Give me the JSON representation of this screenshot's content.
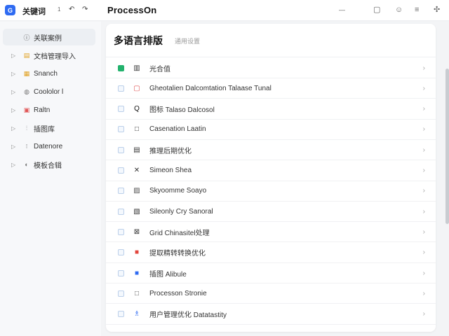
{
  "topbar": {
    "app_name": "关键词",
    "counter": "1",
    "undo_glyph": "↶",
    "redo_glyph": "↷",
    "brand": "ProcessOn"
  },
  "sidebar": {
    "items": [
      {
        "label": "关联案例",
        "icon": "info-circle-icon",
        "glyph": "ⓘ",
        "active": true
      },
      {
        "label": "文档管理导入",
        "icon": "folder-icon",
        "glyph": "▤",
        "active": false
      },
      {
        "label": "Snanch",
        "icon": "orange-box-icon",
        "glyph": "▦",
        "active": false
      },
      {
        "label": "Coololor l",
        "icon": "shield-icon",
        "glyph": "◍",
        "active": false
      },
      {
        "label": "Raltn",
        "icon": "red-file-icon",
        "glyph": "▣",
        "active": false
      },
      {
        "label": "插图库",
        "icon": "tree-icon",
        "glyph": "⫶",
        "active": false
      },
      {
        "label": "Datenore",
        "icon": "dots-icon",
        "glyph": "⁝",
        "active": false
      },
      {
        "label": "模板合辑",
        "icon": "leaf-icon",
        "glyph": "◐",
        "active": false
      }
    ]
  },
  "panel": {
    "title": "多语言排版",
    "subtitle": "通用设置"
  },
  "rows": [
    {
      "label": "光合值",
      "icon": "grid-icon",
      "glyph": "▥",
      "checked": true,
      "color": "#333333"
    },
    {
      "label": "Gheotalien Dalcomtation Talaase Tunal",
      "icon": "lock-icon",
      "glyph": "▢",
      "checked": false,
      "color": "#e05555"
    },
    {
      "label": "图标 Talaso Dalcosol",
      "icon": "q-icon",
      "glyph": "Q",
      "checked": false,
      "color": "#111111"
    },
    {
      "label": "Casenation Laatin",
      "icon": "square-icon",
      "glyph": "□",
      "checked": false,
      "color": "#333333"
    },
    {
      "label": "推理后期优化",
      "icon": "doc-icon",
      "glyph": "▤",
      "checked": false,
      "color": "#333333"
    },
    {
      "label": "Simeon Shea",
      "icon": "crossed-icon",
      "glyph": "✕",
      "checked": false,
      "color": "#333333"
    },
    {
      "label": "Skyoomme Soayo",
      "icon": "image-icon",
      "glyph": "▨",
      "checked": false,
      "color": "#555555"
    },
    {
      "label": "Sileonly Cry Sanoral",
      "icon": "copy-icon",
      "glyph": "▧",
      "checked": false,
      "color": "#333333"
    },
    {
      "label": "Grid Chinasitel处理",
      "icon": "x-grid-icon",
      "glyph": "⊠",
      "checked": false,
      "color": "#333333"
    },
    {
      "label": "提取精转转换优化",
      "icon": "red-square-icon",
      "glyph": "■",
      "checked": false,
      "color": "#e2453c"
    },
    {
      "label": "插图 Alibule",
      "icon": "blue-square-icon",
      "glyph": "■",
      "checked": false,
      "color": "#2f6bf2"
    },
    {
      "label": "Processon Stronie",
      "icon": "outline-square-icon",
      "glyph": "□",
      "checked": false,
      "color": "#555555"
    },
    {
      "label": "用户管理优化 Datatastity",
      "icon": "people-icon",
      "glyph": "♗",
      "checked": false,
      "color": "#2f6bf2"
    }
  ]
}
